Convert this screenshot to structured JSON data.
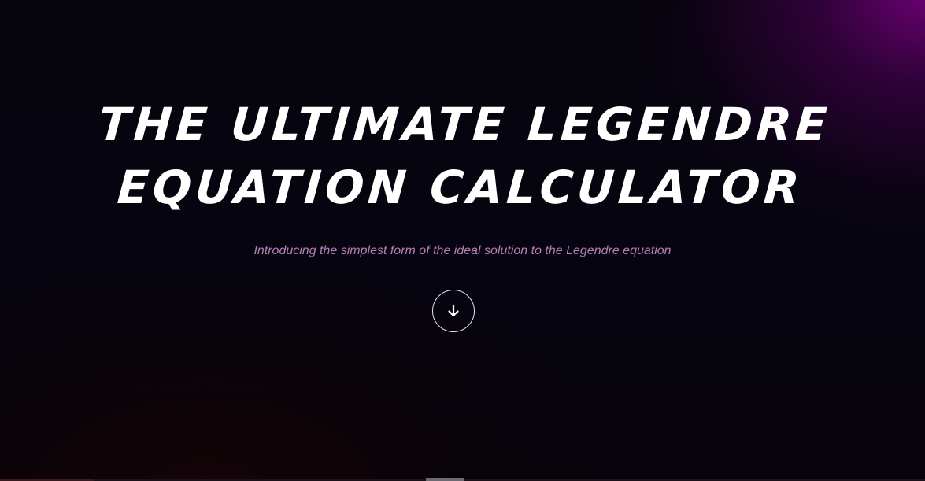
{
  "hero": {
    "title_line_1": "THE ULTIMATE LEGENDRE",
    "title_line_2": "EQUATION CALCULATOR",
    "subtitle": "Introducing the simplest form of the ideal solution to the Legendre equation",
    "scroll_button_icon": "arrow-down-icon"
  },
  "colors": {
    "background": "#05030a",
    "accent_glow": "#700078",
    "title": "#ffffff",
    "subtitle": "#b57fb3",
    "button_border": "#e8e4ee"
  }
}
